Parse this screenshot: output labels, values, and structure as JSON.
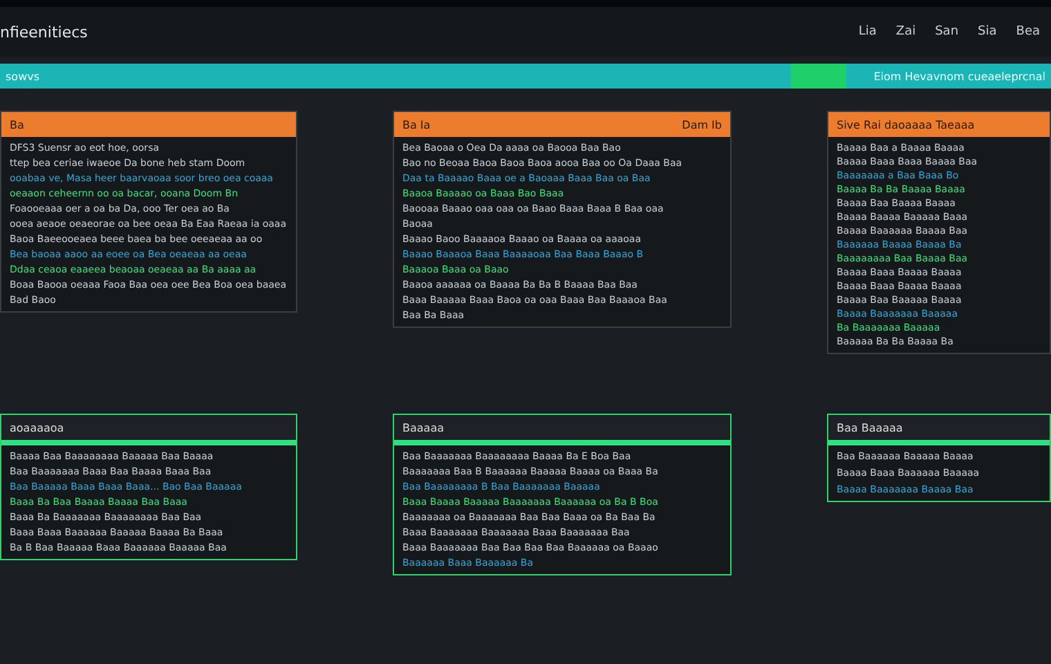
{
  "window": {
    "title": "nfieenitiecs"
  },
  "menu": [
    "Lia",
    "Zai",
    "San",
    "Sia",
    "Bea"
  ],
  "banner": {
    "left": "sowvs",
    "right": "Eiom Hevavnom cueaeleprcnal"
  },
  "panels": [
    {
      "title": "Ba",
      "lines": [
        "DFS3 Suensr ao eot hoe, oorsa",
        "ttep bea ceriae iwaeoe Da bone heb stam Doom",
        "ooabaa ve, Masa heer baarvaoaa soor breo oea coaaa",
        "oeaaon ceheernn oo oa bacar, ooana Doom Bn",
        "Foaooeaaa oer a oa ba Da, ooo Ter oea ao Ba",
        "ooea aeaoe oeaeorae oa bee oeaa Ba Eaa Raeaa ia oaaa",
        "Baoa Baeeooeaea beee baea ba bee oeeaeaa aa oo",
        "Bea baoaa aaoo aa eoee oa Bea oeaeaa aa oeaa",
        "Ddaa ceaoa eaaeea beaoaa oeaeaa aa Ba aaaa aa",
        "Boaa Baooa oeaaa Faoa Baa oea oee Bea Boa oea baaea",
        "Bad Baoo"
      ]
    },
    {
      "title": "Ba Ia",
      "subtitle": "Dam Ib",
      "lines": [
        "Bea Baoaa o Oea Da aaaa oa Baooa Baa Bao",
        "Bao no Beoaa Baoa Baoa Baoa aooa Baa oo Oa Daaa Baa",
        "Daa ta Baaaao Baaa oe a Baoaaa Baaa Baa oa Baa",
        "Baaoa Baaaao oa Baaa Bao Baaa",
        "Baooaa Baaao oaa oaa oa Baao Baaa Baaa B Baa oaa",
        "Baoaa",
        "Baaao Baoo Baaaaoa Baaao oa Baaaa oa aaaoaa",
        "Baaao Baaaoa Baaa Baaaaoaa Baa Baaa Baaao B",
        "Baaaoa Baaa oa Baao",
        "Baaoa aaaaaa oa Baaaa Ba Ba B Baaaa Baa Baa",
        "Baaa Baaaaa Baaa Baoa oa oaa Baaa Baa Baaaoa Baa",
        "Baa Ba Baaa"
      ]
    },
    {
      "title": "Sive Rai daoaaaa Taeaaa",
      "lines": [
        "Baaaa Baa a Baaaa Baaaa",
        "Baaaa Baaa Baaa Baaaa Baa",
        "Baaaaaaa a Baa Baaa Bo",
        "Baaaa Ba Ba Baaaa Baaaa",
        "Baaaa Baa Baaaa Baaaa",
        "Baaaa Baaaa Baaaaa Baaa",
        "Baaaa Baaaaaa Baaaa Baa",
        "Baaaaaa Baaaa Baaaa Ba",
        "Baaaaaaaa Baa Baaaa Baa",
        "Baaaa Baaa Baaaa Baaaa",
        "Baaaa Baaa Baaaa Baaaa",
        "Baaaa Baa Baaaaa Baaaa",
        "Baaaa Baaaaaaa Baaaaa",
        "Ba Baaaaaaa Baaaaa",
        "Baaaaa Ba Ba Baaaa Ba"
      ]
    },
    {
      "title": "aoaaaaoa",
      "lines": [
        "Baaaa Baa Baaaaaaaa Baaaaa Baa Baaaa",
        "Baa Baaaaaaa Baaa Baa Baaaa Baaa Baa",
        "Baa Baaaaa Baaa Baaa Baaa... Bao Baa Baaaaa",
        "Baaa Ba Baa Baaaa Baaaa Baa Baaa",
        "Baaa Ba Baaaaaaa Baaaaaaaa Baa Baa",
        "Baaa Baaa Baaaaaa Baaaaa Baaaa Ba Baaa",
        "Ba B Baa Baaaaa Baaa Baaaaaa Baaaaa Baa"
      ]
    },
    {
      "title": "Baaaaa",
      "lines": [
        "Baa Baaaaaaa Baaaaaaaa Baaaa Ba E Boa Baa",
        "Baaaaaaa Baa B Baaaaaa Baaaaa Baaaa oa Baaa Ba",
        "Baa Baaaaaaaa B Baa Baaaaaaa Baaaaa",
        "Baaa Baaaa Baaaaa Baaaaaaa Baaaaaa oa Ba B Boa",
        "Baaaaaaa oa Baaaaaaa Baa Baa Baaa oa Ba Baa Ba",
        "Baaa Baaaaaaa Baaaaaaa Baaa Baaaaaaa Baa",
        "Baaa Baaaaaaa Baa Baa Baa Baa Baaaaaa oa Baaao",
        "Baaaaaa Baaa Baaaaaa Ba"
      ]
    },
    {
      "title": "Baa Baaaaa",
      "lines": [
        "Baa Baaaaaa Baaaaa Baaaa",
        "Baaaa Baaa Baaaaaa Baaaaa",
        "Baaaa Baaaaaaa Baaaa Baa"
      ]
    }
  ]
}
